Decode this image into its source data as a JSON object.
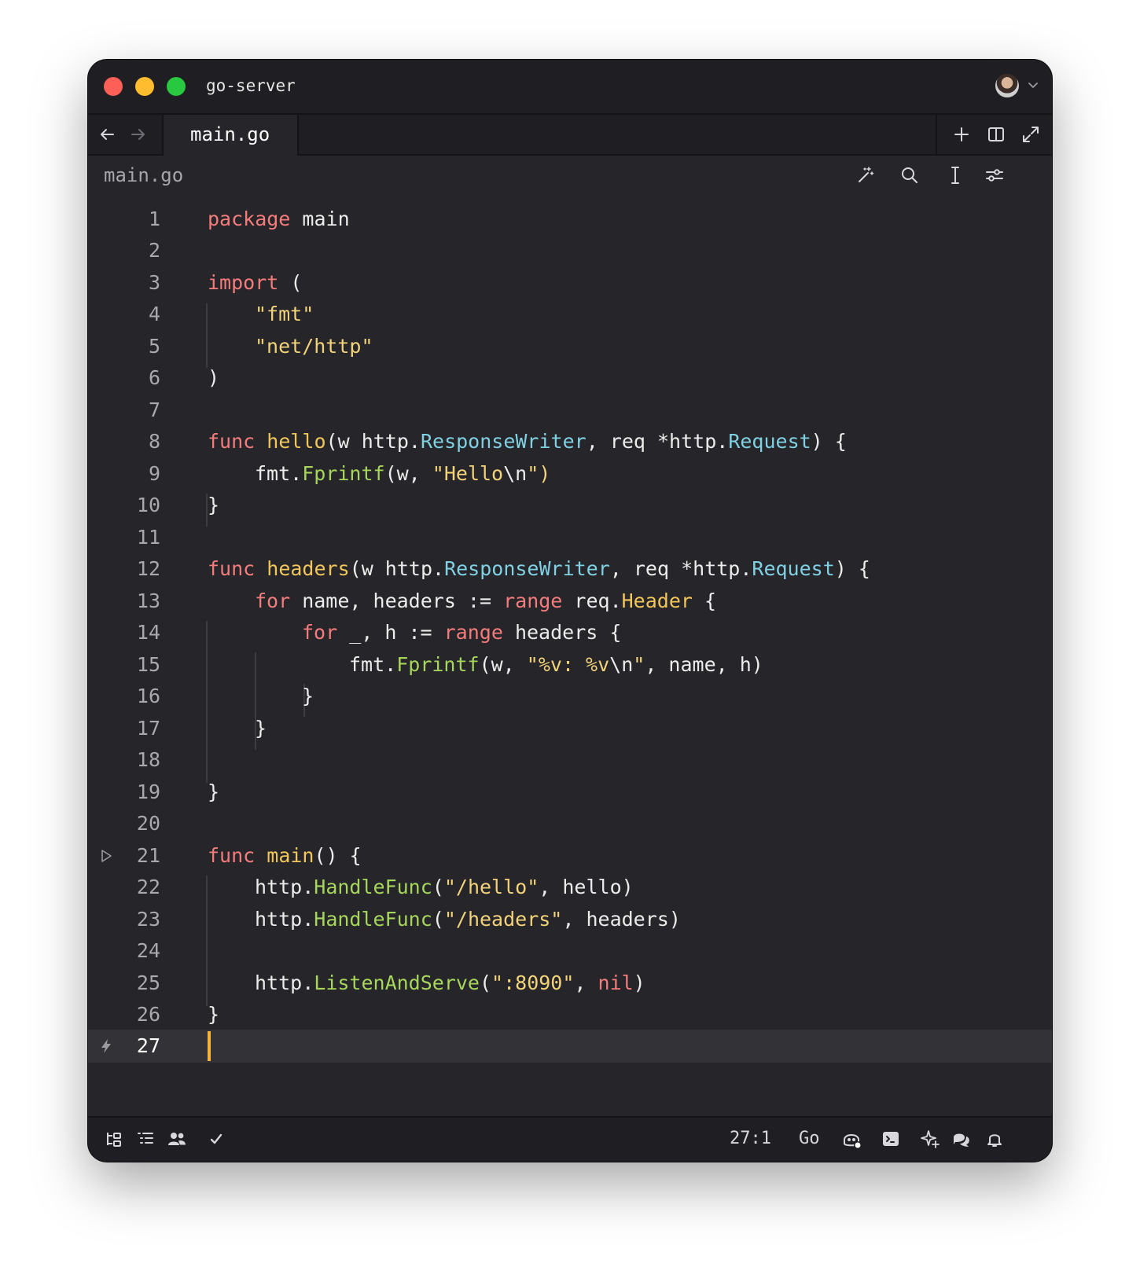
{
  "window": {
    "title": "go-server"
  },
  "tabs": [
    {
      "label": "main.go",
      "active": true
    }
  ],
  "breadcrumb": "main.go",
  "toolbar_icons": [
    "magic-wand-icon",
    "search-icon",
    "text-cursor-icon",
    "sliders-icon"
  ],
  "tab_action_icons": [
    "plus-icon",
    "split-view-icon",
    "expand-icon"
  ],
  "editor": {
    "language": "Go",
    "current_line": 27,
    "lines": [
      {
        "n": "1"
      },
      {
        "n": "2"
      },
      {
        "n": "3"
      },
      {
        "n": "4"
      },
      {
        "n": "5"
      },
      {
        "n": "6"
      },
      {
        "n": "7"
      },
      {
        "n": "8"
      },
      {
        "n": "9"
      },
      {
        "n": "10"
      },
      {
        "n": "11"
      },
      {
        "n": "12"
      },
      {
        "n": "13"
      },
      {
        "n": "14"
      },
      {
        "n": "15"
      },
      {
        "n": "16"
      },
      {
        "n": "17"
      },
      {
        "n": "18"
      },
      {
        "n": "19"
      },
      {
        "n": "20"
      },
      {
        "n": "21"
      },
      {
        "n": "22"
      },
      {
        "n": "23"
      },
      {
        "n": "24"
      },
      {
        "n": "25"
      },
      {
        "n": "26"
      },
      {
        "n": "27"
      }
    ],
    "tokens": {
      "l1": [
        "package",
        " main"
      ],
      "l3": [
        "import",
        " ("
      ],
      "l4": [
        "\"fmt\""
      ],
      "l5": [
        "\"net/http\""
      ],
      "l6": [
        ")"
      ],
      "l8": [
        "func",
        " ",
        "hello",
        "(w http.",
        "ResponseWriter",
        ", req *http.",
        "Request",
        ") {"
      ],
      "l9": [
        "fmt.",
        "Fprintf",
        "(w, ",
        "\"Hello",
        "\\n",
        "\")"
      ],
      "l10": [
        "}"
      ],
      "l12": [
        "func",
        " ",
        "headers",
        "(w http.",
        "ResponseWriter",
        ", req *http.",
        "Request",
        ") {"
      ],
      "l13": [
        "for",
        " name, headers := ",
        "range",
        " req.",
        "Header",
        " {"
      ],
      "l14": [
        "for",
        " _, h := ",
        "range",
        " headers {"
      ],
      "l15": [
        "fmt.",
        "Fprintf",
        "(w, ",
        "\"%v: %v",
        "\\n",
        "\"",
        ", name, h)"
      ],
      "l16": [
        "}"
      ],
      "l17": [
        "}"
      ],
      "l19": [
        "}"
      ],
      "l21": [
        "func",
        " ",
        "main",
        "() {"
      ],
      "l22": [
        "http.",
        "HandleFunc",
        "(",
        "\"/hello\"",
        ", hello)"
      ],
      "l23": [
        "http.",
        "HandleFunc",
        "(",
        "\"/headers\"",
        ", headers)"
      ],
      "l25": [
        "http.",
        "ListenAndServe",
        "(",
        "\":8090\"",
        ", ",
        "nil",
        ")"
      ],
      "l26": [
        "}"
      ]
    }
  },
  "statusbar": {
    "position": "27:1",
    "language": "Go",
    "left_icons": [
      "file-tree-icon",
      "outline-icon",
      "collaborators-icon",
      "checkmark-icon"
    ],
    "right_icons": [
      "copilot-icon",
      "terminal-icon",
      "ai-sparkle-icon",
      "chat-icon",
      "bell-icon"
    ]
  },
  "colors": {
    "background": "#262529",
    "keyword": "#f47c7c",
    "function": "#f1c65a",
    "type": "#7fd1e3",
    "method": "#a7d65c",
    "string": "#f3d37a",
    "cursor": "#f4b43c"
  }
}
